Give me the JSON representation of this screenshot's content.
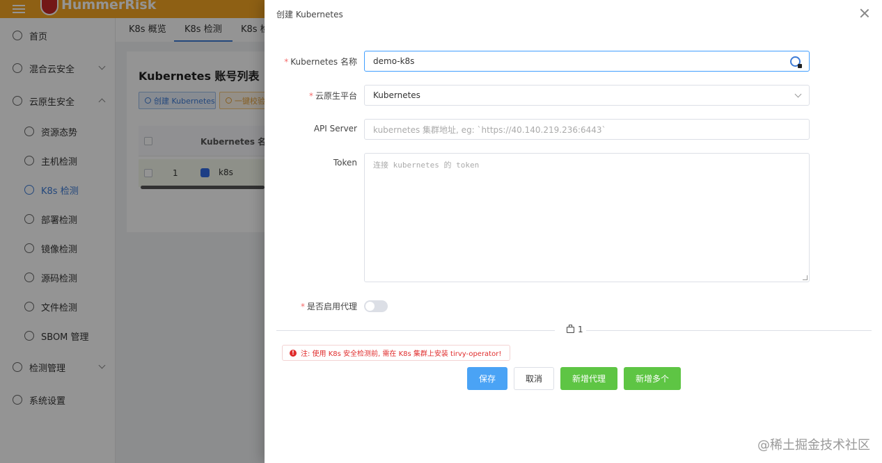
{
  "app": {
    "brand": "HummerRisk"
  },
  "sidebar": {
    "items": [
      {
        "label": "首页",
        "icon": "clock-icon"
      },
      {
        "label": "混合云安全",
        "icon": "cloud-icon"
      },
      {
        "label": "云原生安全",
        "icon": "cloud-native-icon"
      },
      {
        "label": "资源态势",
        "icon": "radar-icon"
      },
      {
        "label": "主机检测",
        "icon": "server-icon"
      },
      {
        "label": "K8s 检测",
        "icon": "kubernetes-icon"
      },
      {
        "label": "部署检测",
        "icon": "layers-icon"
      },
      {
        "label": "镜像检测",
        "icon": "docker-icon"
      },
      {
        "label": "源码检测",
        "icon": "code-icon"
      },
      {
        "label": "文件检测",
        "icon": "file-icon"
      },
      {
        "label": "SBOM 管理",
        "icon": "sbom-icon"
      },
      {
        "label": "检测管理",
        "icon": "grid-icon"
      },
      {
        "label": "系统设置",
        "icon": "settings-icon"
      }
    ]
  },
  "tabs": [
    "K8s 概览",
    "K8s 检测",
    "K8s 检"
  ],
  "card": {
    "title": "Kubernetes 账号列表",
    "create_button": "创建 Kubernetes",
    "onekey_button": "一键校验",
    "column_name": "Kubernetes 名称",
    "rows": [
      {
        "index": "1",
        "name": "k8s"
      }
    ]
  },
  "drawer": {
    "title": "创建 Kubernetes",
    "form": {
      "name_label": "Kubernetes 名称",
      "name_value": "demo-k8s",
      "platform_label": "云原生平台",
      "platform_value": "Kubernetes",
      "api_label": "API Server",
      "api_placeholder": "kubernetes 集群地址, eg: `https://40.140.219.236:6443`",
      "token_label": "Token",
      "token_placeholder": "连接 kubernetes 的 token",
      "proxy_label": "是否启用代理",
      "proxy_enabled": false
    },
    "divider_count": "1",
    "notice": "注: 使用 K8s 安全检测前, 需在 K8s 集群上安装 tirvy-operator!",
    "buttons": {
      "save": "保存",
      "cancel": "取消",
      "add_proxy": "新增代理",
      "add_multiple": "新增多个"
    }
  },
  "watermark": "@稀土掘金技术社区",
  "colors": {
    "accent": "#3d7bd6",
    "topbar": "#f5a623",
    "primary_button": "#4aa3f5",
    "success_button": "#5ec544",
    "danger_text": "#e02d2d"
  }
}
